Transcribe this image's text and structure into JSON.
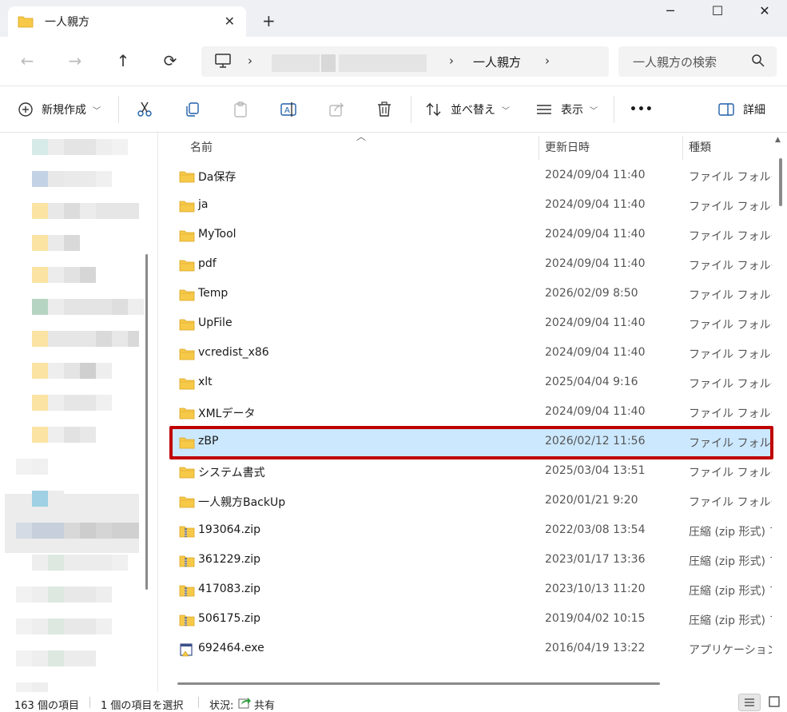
{
  "window": {
    "tab_title": "一人親方",
    "tab_close": "✕",
    "new_tab": "+",
    "minimize": "─",
    "maximize": "☐",
    "close": "✕"
  },
  "nav": {
    "back": "←",
    "forward": "→",
    "up": "↑",
    "refresh": "⟳",
    "breadcrumb_current": "一人親方",
    "separator": "›",
    "search_placeholder": "一人親方の検索"
  },
  "toolbar": {
    "new_label": "新規作成",
    "sort_label": "並べ替え",
    "view_label": "表示",
    "more_label": "•••",
    "details_label": "詳細"
  },
  "columns": {
    "name": "名前",
    "date": "更新日時",
    "type": "種類"
  },
  "files": [
    {
      "name": "Da保存",
      "date": "2024/09/04 11:40",
      "type": "ファイル フォルダー",
      "icon": "folder-icon"
    },
    {
      "name": "ja",
      "date": "2024/09/04 11:40",
      "type": "ファイル フォルダー",
      "icon": "folder-icon"
    },
    {
      "name": "MyTool",
      "date": "2024/09/04 11:40",
      "type": "ファイル フォルダー",
      "icon": "folder-icon"
    },
    {
      "name": "pdf",
      "date": "2024/09/04 11:40",
      "type": "ファイル フォルダー",
      "icon": "folder-icon"
    },
    {
      "name": "Temp",
      "date": "2026/02/09 8:50",
      "type": "ファイル フォルダー",
      "icon": "folder-icon"
    },
    {
      "name": "UpFile",
      "date": "2024/09/04 11:40",
      "type": "ファイル フォルダー",
      "icon": "folder-icon"
    },
    {
      "name": "vcredist_x86",
      "date": "2024/09/04 11:40",
      "type": "ファイル フォルダー",
      "icon": "folder-icon"
    },
    {
      "name": "xlt",
      "date": "2025/04/04 9:16",
      "type": "ファイル フォルダー",
      "icon": "folder-icon"
    },
    {
      "name": "XMLデータ",
      "date": "2024/09/04 11:40",
      "type": "ファイル フォルダー",
      "icon": "folder-icon"
    },
    {
      "name": "zBP",
      "date": "2026/02/12 11:56",
      "type": "ファイル フォルダー",
      "icon": "folder-icon",
      "selected": true
    },
    {
      "name": "システム書式",
      "date": "2025/03/04 13:51",
      "type": "ファイル フォルダー",
      "icon": "folder-icon"
    },
    {
      "name": "一人親方BackUp",
      "date": "2020/01/21 9:20",
      "type": "ファイル フォルダー",
      "icon": "folder-icon"
    },
    {
      "name": "193064.zip",
      "date": "2022/03/08 13:54",
      "type": "圧縮 (zip 形式) フォルダー",
      "icon": "zip-folder-icon"
    },
    {
      "name": "361229.zip",
      "date": "2023/01/17 13:36",
      "type": "圧縮 (zip 形式) フォルダー",
      "icon": "zip-folder-icon"
    },
    {
      "name": "417083.zip",
      "date": "2023/10/13 11:20",
      "type": "圧縮 (zip 形式) フォルダー",
      "icon": "zip-folder-icon"
    },
    {
      "name": "506175.zip",
      "date": "2019/04/02 10:15",
      "type": "圧縮 (zip 形式) フォルダー",
      "icon": "zip-folder-icon"
    },
    {
      "name": "692464.exe",
      "date": "2016/04/19 13:22",
      "type": "アプリケーション",
      "icon": "exe-icon"
    }
  ],
  "status": {
    "item_count": "163 個の項目",
    "selected_count": "1 個の項目を選択",
    "state_label": "状況:",
    "shared_label": "共有"
  },
  "colors": {
    "folder": "#f7c948",
    "selection": "#cce8ff",
    "highlight_border": "#c00000",
    "accent": "#005fb8"
  }
}
